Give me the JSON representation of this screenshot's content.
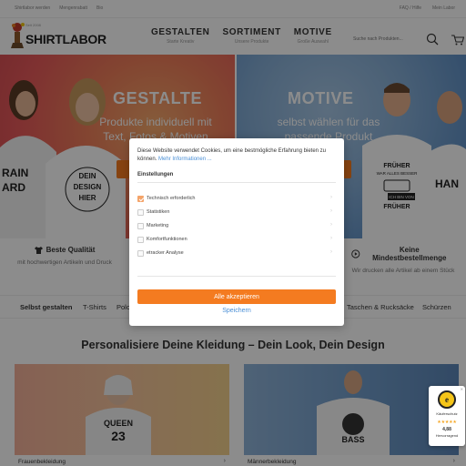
{
  "topbar": {
    "left": [
      "Shirtlabor werden",
      "Mengenrabatt",
      "Bio"
    ],
    "right": [
      "FAQ / Hilfe",
      "Mein Labor"
    ]
  },
  "logo": {
    "small": "Seit 2008",
    "word_1": "SHIRT",
    "word_2": "LABOR"
  },
  "nav": [
    {
      "title": "GESTALTEN",
      "sub": "Starte Kreativ"
    },
    {
      "title": "SORTIMENT",
      "sub": "Unsere Produkte"
    },
    {
      "title": "MOTIVE",
      "sub": "Große Auswahl"
    }
  ],
  "search": {
    "placeholder": "Suche nach Produkten..."
  },
  "hero": {
    "left": {
      "title": "GESTALTE",
      "sub": "Produkte individuell mit Text, Fotos & Motiven"
    },
    "right": {
      "title": "MOTIVE",
      "sub": "selbst wählen für das passende Produkt"
    },
    "shirt_texts": [
      "RAIN ARD",
      "HIER DEIN DESIGN",
      "FRÜHER WAR ALLES BESSER",
      "ICH BIN VON FRÜHER",
      "HAN"
    ]
  },
  "features": [
    {
      "title": "Beste Qualität",
      "desc": "mit hochwertigen Artikeln und Druck"
    },
    {
      "title": "Keine Mindestbestellmenge",
      "desc": "Wir drucken alle Artikel ab einem Stück"
    }
  ],
  "categories": [
    "Selbst gestalten",
    "T-Shirts",
    "Polo",
    "Taschen & Rucksäcke",
    "Schürzen"
  ],
  "personalize": {
    "title": "Personalisiere Deine Kleidung – Dein Look, Dein Design",
    "cards": [
      {
        "label": "Frauenbekleidung",
        "shirt_text": "QUEEN 23"
      },
      {
        "label": "Männerbekleidung",
        "shirt_text": "BASS"
      }
    ]
  },
  "cookie": {
    "intro": "Diese Website verwendet Cookies, um eine bestmögliche Erfahrung bieten zu können.",
    "more_link": "Mehr Informationen ...",
    "settings_heading": "Einstellungen",
    "options": [
      {
        "label": "Technisch erforderlich",
        "checked": true
      },
      {
        "label": "Statistiken",
        "checked": false
      },
      {
        "label": "Marketing",
        "checked": false
      },
      {
        "label": "Komfortfunktionen",
        "checked": false
      },
      {
        "label": "etracker Analyse",
        "checked": false
      }
    ],
    "accept_label": "Alle akzeptieren",
    "save_label": "Speichern"
  },
  "trust": {
    "label": "Käuferschutz",
    "stars": "★★★★★",
    "score": "4,88",
    "rating": "Hervorragend",
    "seal": "e"
  },
  "colors": {
    "accent": "#f47b20",
    "link": "#4a8fd6",
    "brand_red": "#d0021b"
  }
}
